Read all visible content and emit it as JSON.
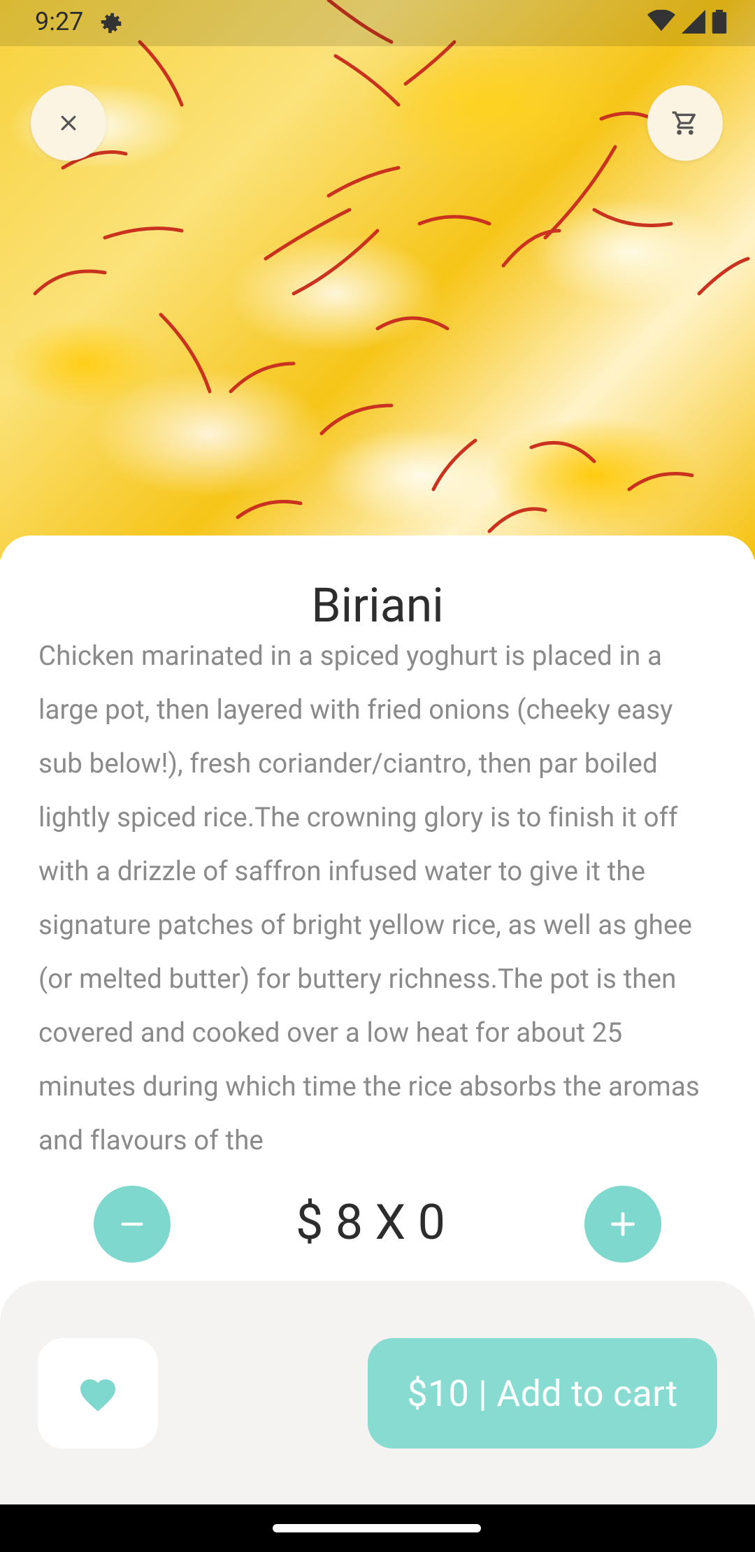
{
  "status_bar": {
    "time": "9:27"
  },
  "hero": {
    "icons": [
      "close-icon",
      "cart-icon"
    ]
  },
  "product": {
    "title": "Biriani",
    "description": "Chicken marinated in a spiced yoghurt is placed in a large pot, then layered with fried onions (cheeky easy sub below!), fresh coriander/ciantro, then par boiled lightly spiced rice.The crowning glory is to finish it off with a drizzle of saffron infused water to give it the signature patches of bright yellow rice, as well as ghee (or melted butter) for buttery richness.The pot is then covered and cooked over a low heat for about 25 minutes during which time the rice absorbs the aromas and flavours of the"
  },
  "quantity": {
    "display": "$ 8 X 0"
  },
  "actions": {
    "add_to_cart_label": "$10 | Add to cart",
    "favorite_icon": "heart-icon"
  },
  "colors": {
    "accent": "#7fd8cd",
    "button_accent": "#88dbd0",
    "panel_bg": "#f4f3f1",
    "close_button_bg": "#fbf4e3"
  }
}
